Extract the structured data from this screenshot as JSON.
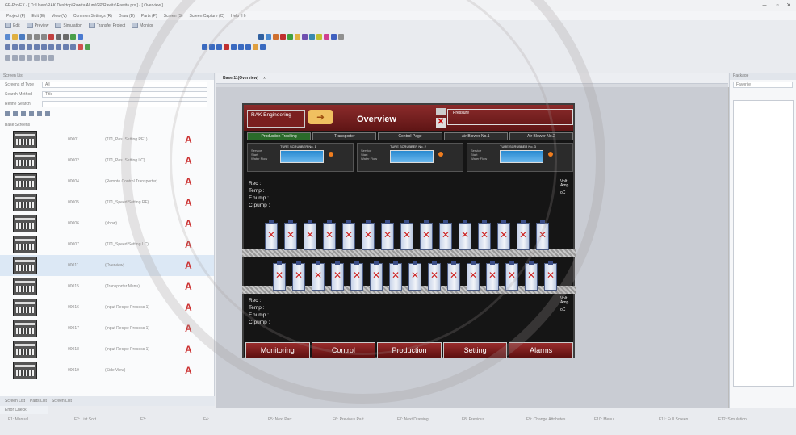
{
  "titlebar": {
    "text": "GP-Pro EX - [ D:\\Users\\RAK Desktop\\Rawita Alum\\GP\\Rawita\\Rawita.prx ] - [ Overview ]"
  },
  "menu": [
    "Project (F)",
    "Edit (E)",
    "View (V)",
    "Common Settings (R)",
    "Draw (D)",
    "Parts (P)",
    "Screen (S)",
    "Screen Capture (C)",
    "Help (H)"
  ],
  "modes": [
    "Edit",
    "Preview",
    "Simulation",
    "Transfer Project",
    "Monitor"
  ],
  "left": {
    "title": "Screen List",
    "type_label": "Screens of Type",
    "type_value": "All",
    "method_label": "Search Method",
    "method_value": "Title",
    "refine_label": "Refine Search",
    "refine_value": "",
    "tree_label": "Base Screens",
    "items": [
      {
        "num": "00001",
        "name": "(T01_Pos. Setting RF1)"
      },
      {
        "num": "00002",
        "name": "(T01_Pos. Setting LC)"
      },
      {
        "num": "00004",
        "name": "(Remote Control Transporter)"
      },
      {
        "num": "00005",
        "name": "(T01_Speed Setting RF)"
      },
      {
        "num": "00006",
        "name": "(show)"
      },
      {
        "num": "00007",
        "name": "(T01_Speed Setting LC)"
      },
      {
        "num": "00011",
        "name": "(Overview)"
      },
      {
        "num": "00015",
        "name": "(Transporter Menu)"
      },
      {
        "num": "00016",
        "name": "(Input Recipe Process 1)"
      },
      {
        "num": "00017",
        "name": "(Input Recipe Process 1)"
      },
      {
        "num": "00018",
        "name": "(Input Recipe Process 1)"
      },
      {
        "num": "00019",
        "name": "(Side View)"
      }
    ],
    "amark": "A",
    "tabs": [
      "Screen List",
      "Parts List",
      "Screen List"
    ]
  },
  "error_check": "Error Check",
  "status": {
    "f1": "F1: Manual",
    "f2": "F2: List Sort",
    "f3": "F3:",
    "f4": "F4:",
    "f5": "F5: Next Part",
    "f6": "F6: Previous Part",
    "f7": "F7: Next Drawing",
    "f8": "F8: Previous",
    "f9": "F9: Change Attributes",
    "f10": "F10: Menu",
    "f11": "F11: Full Screen",
    "f12": "F12: Simulation"
  },
  "center": {
    "tab": "Base 11(Overview)",
    "tab_x": "x"
  },
  "hmi": {
    "logo": "RAK Engineering",
    "title": "Overview",
    "info": "Pressure",
    "nav": [
      "Production Tracking",
      "Transporter",
      "Control Page",
      "Air Blower No.1",
      "Air Blower No.2"
    ],
    "unit_name": "TURE SCRUBBER No. 1",
    "unit_name2": "TURE SCRUBBER No. 2",
    "unit_name3": "TURE SCRUBBER No. 3",
    "unit_stat": [
      "Service",
      "Start",
      "Water Flow"
    ],
    "rows_top": [
      "Rec :",
      "Temp :",
      "F.pump :",
      "C.pump :"
    ],
    "rows_bot": [
      "Rec :",
      "Temp :",
      "F.pump :",
      "C.pump :"
    ],
    "volt": "Volt",
    "amp": "Amp",
    "oc": "oC",
    "tabs": [
      "Monitoring",
      "Control",
      "Production",
      "Setting",
      "Alarms"
    ]
  },
  "right": {
    "title": "Package",
    "value": "Favorite"
  }
}
